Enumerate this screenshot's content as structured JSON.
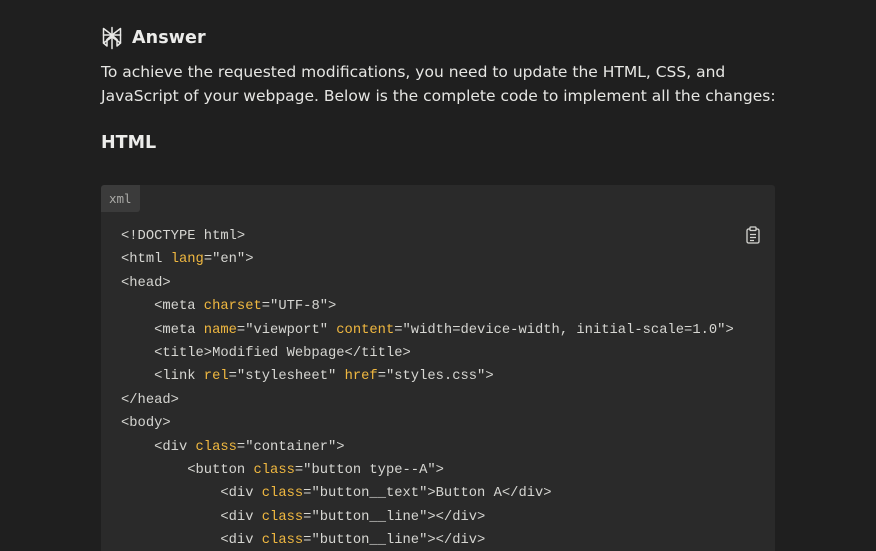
{
  "answer": {
    "icon": "perplexity-logo-icon",
    "title": "Answer"
  },
  "intro_text": "To achieve the requested modifications, you need to update the HTML, CSS, and JavaScript of your webpage. Below is the complete code to implement all the changes:",
  "section_heading": "HTML",
  "code_block": {
    "language": "xml",
    "copy_icon": "clipboard-icon",
    "colors": {
      "attribute": "#f0b840",
      "text": "#d6d6d2",
      "background": "#2a2a2a"
    },
    "lines": [
      [
        {
          "t": "tag",
          "v": "<!DOCTYPE html>"
        }
      ],
      [
        {
          "t": "tag",
          "v": "<html "
        },
        {
          "t": "attr",
          "v": "lang"
        },
        {
          "t": "tag",
          "v": "="
        },
        {
          "t": "str",
          "v": "\"en\""
        },
        {
          "t": "tag",
          "v": ">"
        }
      ],
      [
        {
          "t": "tag",
          "v": "<head>"
        }
      ],
      [
        {
          "t": "tag",
          "v": "    <meta "
        },
        {
          "t": "attr",
          "v": "charset"
        },
        {
          "t": "tag",
          "v": "="
        },
        {
          "t": "str",
          "v": "\"UTF-8\""
        },
        {
          "t": "tag",
          "v": ">"
        }
      ],
      [
        {
          "t": "tag",
          "v": "    <meta "
        },
        {
          "t": "attr",
          "v": "name"
        },
        {
          "t": "tag",
          "v": "="
        },
        {
          "t": "str",
          "v": "\"viewport\""
        },
        {
          "t": "tag",
          "v": " "
        },
        {
          "t": "attr",
          "v": "content"
        },
        {
          "t": "tag",
          "v": "="
        },
        {
          "t": "str",
          "v": "\"width=device-width, initial-scale=1.0\""
        },
        {
          "t": "tag",
          "v": ">"
        }
      ],
      [
        {
          "t": "tag",
          "v": "    <title>Modified Webpage</title>"
        }
      ],
      [
        {
          "t": "tag",
          "v": "    <link "
        },
        {
          "t": "attr",
          "v": "rel"
        },
        {
          "t": "tag",
          "v": "="
        },
        {
          "t": "str",
          "v": "\"stylesheet\""
        },
        {
          "t": "tag",
          "v": " "
        },
        {
          "t": "attr",
          "v": "href"
        },
        {
          "t": "tag",
          "v": "="
        },
        {
          "t": "str",
          "v": "\"styles.css\""
        },
        {
          "t": "tag",
          "v": ">"
        }
      ],
      [
        {
          "t": "tag",
          "v": "</head>"
        }
      ],
      [
        {
          "t": "tag",
          "v": "<body>"
        }
      ],
      [
        {
          "t": "tag",
          "v": "    <div "
        },
        {
          "t": "attr",
          "v": "class"
        },
        {
          "t": "tag",
          "v": "="
        },
        {
          "t": "str",
          "v": "\"container\""
        },
        {
          "t": "tag",
          "v": ">"
        }
      ],
      [
        {
          "t": "tag",
          "v": "        <button "
        },
        {
          "t": "attr",
          "v": "class"
        },
        {
          "t": "tag",
          "v": "="
        },
        {
          "t": "str",
          "v": "\"button type--A\""
        },
        {
          "t": "tag",
          "v": ">"
        }
      ],
      [
        {
          "t": "tag",
          "v": "            <div "
        },
        {
          "t": "attr",
          "v": "class"
        },
        {
          "t": "tag",
          "v": "="
        },
        {
          "t": "str",
          "v": "\"button__text\""
        },
        {
          "t": "tag",
          "v": ">Button A</div>"
        }
      ],
      [
        {
          "t": "tag",
          "v": "            <div "
        },
        {
          "t": "attr",
          "v": "class"
        },
        {
          "t": "tag",
          "v": "="
        },
        {
          "t": "str",
          "v": "\"button__line\""
        },
        {
          "t": "tag",
          "v": "></div>"
        }
      ],
      [
        {
          "t": "tag",
          "v": "            <div "
        },
        {
          "t": "attr",
          "v": "class"
        },
        {
          "t": "tag",
          "v": "="
        },
        {
          "t": "str",
          "v": "\"button__line\""
        },
        {
          "t": "tag",
          "v": "></div>"
        }
      ]
    ]
  }
}
